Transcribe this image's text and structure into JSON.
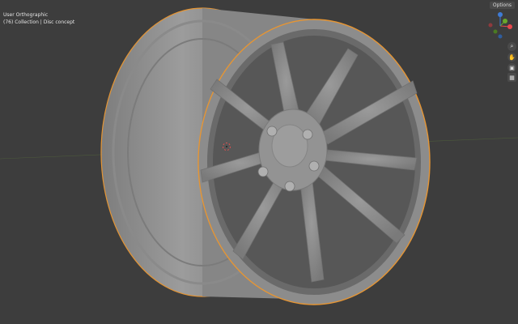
{
  "viewport": {
    "title": "User Orthographic",
    "collection": "(76) Collection | Disc concept",
    "options_label": "Options"
  },
  "gizmo": {
    "axis_colors": {
      "x": "#e8484d",
      "y": "#6aa92b",
      "z": "#3e7bd6"
    },
    "labels": {
      "x": "X",
      "y": "Y",
      "z": "Z"
    }
  },
  "nav_icons": [
    "zoom-icon",
    "hand-pan-icon",
    "camera-icon",
    "grid-icon"
  ],
  "colors": {
    "background": "#3d3d3d",
    "selection_outline": "#e59534",
    "mesh": "#8e8e8e"
  }
}
